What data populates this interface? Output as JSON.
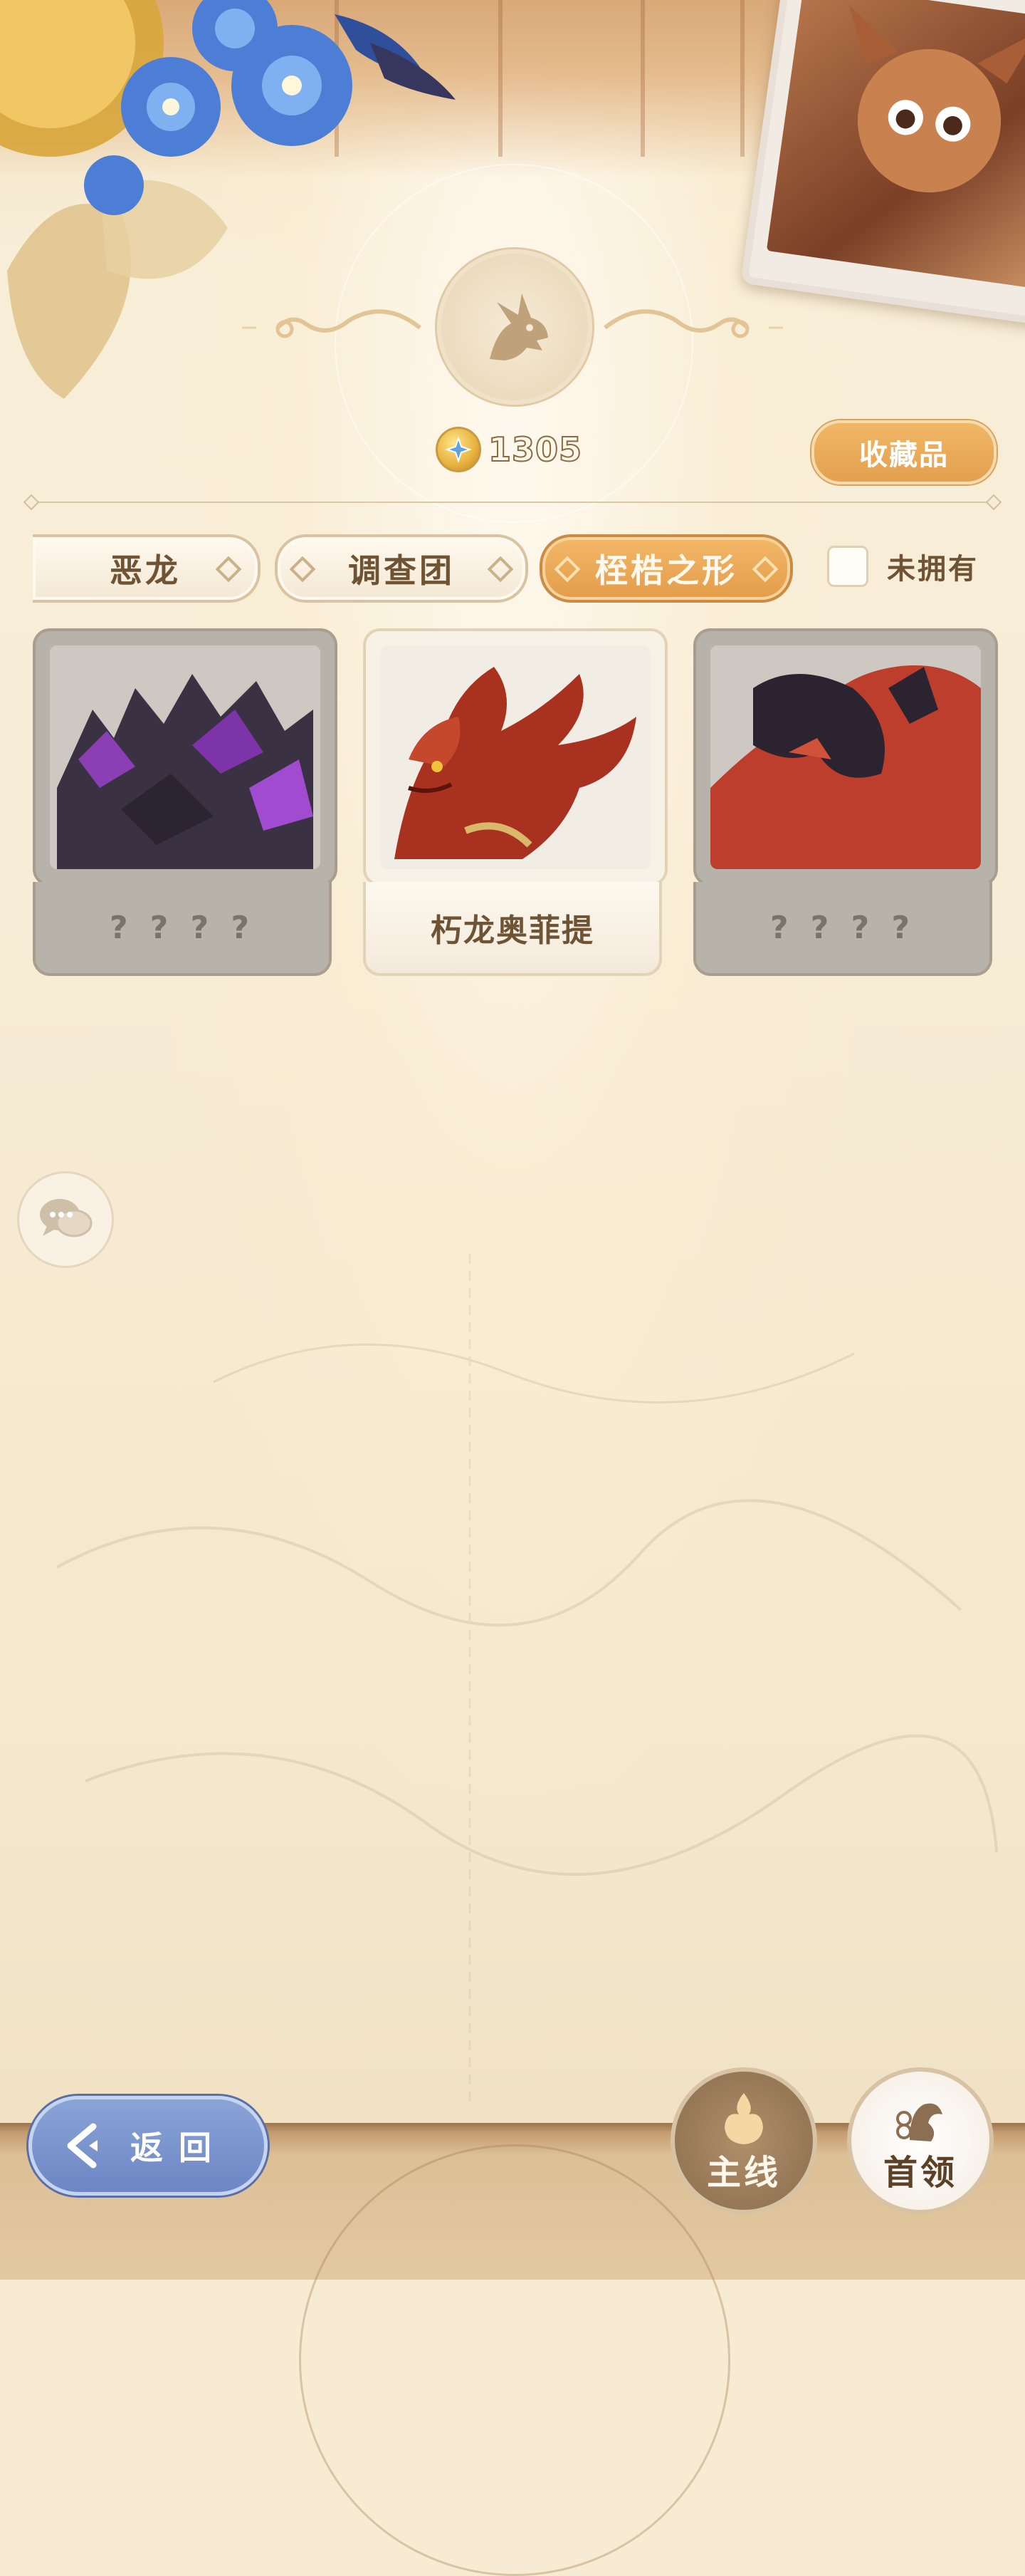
{
  "header": {
    "currency_value": "1305",
    "collections_label": "收藏品"
  },
  "tabs": [
    {
      "label": "恶龙",
      "active": false
    },
    {
      "label": "调查团",
      "active": false
    },
    {
      "label": "桎梏之形",
      "active": true
    }
  ],
  "filter": {
    "owned_label": "未拥有",
    "checked": false
  },
  "cards": [
    {
      "name": "? ? ? ?",
      "owned": false
    },
    {
      "name": "朽龙奥菲提",
      "owned": true
    },
    {
      "name": "? ? ? ?",
      "owned": false
    }
  ],
  "footer": {
    "back_label": "返回",
    "main_label": "主线",
    "boss_label": "首领"
  },
  "colors": {
    "accent_orange": "#e3a04f",
    "back_blue": "#6d86c4",
    "text_brown": "#6e5334"
  }
}
